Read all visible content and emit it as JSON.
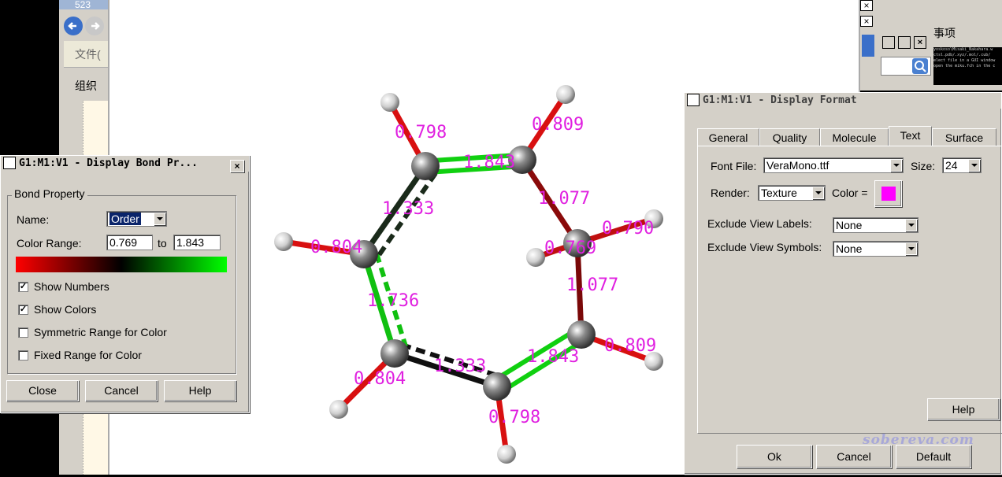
{
  "background": {
    "explorer_title": "523",
    "menu_file": "文件(",
    "menu_organize": "组织",
    "topright_text": "事项",
    "terminal_lines": [
      "yoskoso\\Misaki_Nakahara.w",
      "ctsl.pdb/.xyz/.mol/.cub/",
      "elect file in a GUI window",
      "open the miku.fch in the c"
    ]
  },
  "bond_dialog": {
    "title": "G1:M1:V1 - Display Bond Pr...",
    "group_label": "Bond Property",
    "name_label": "Name:",
    "name_value": "Order",
    "color_range_label": "Color Range:",
    "range_min": "0.769",
    "range_to": "to",
    "range_max": "1.843",
    "checkboxes": [
      {
        "label": "Show Numbers",
        "checked": true
      },
      {
        "label": "Show Colors",
        "checked": true
      },
      {
        "label": "Symmetric Range for Color",
        "checked": false
      },
      {
        "label": "Fixed Range for Color",
        "checked": false
      }
    ],
    "buttons": {
      "close": "Close",
      "cancel": "Cancel",
      "help": "Help"
    },
    "gradient_colors": [
      "#ff0000",
      "#000000",
      "#00ff00"
    ]
  },
  "format_dialog": {
    "title": "G1:M1:V1 - Display Format",
    "tabs": [
      "General",
      "Quality",
      "Molecule",
      "Text",
      "Surface"
    ],
    "active_tab": "Text",
    "font_file_label": "Font File:",
    "font_file_value": "VeraMono.ttf",
    "size_label": "Size:",
    "size_value": "24",
    "render_label": "Render:",
    "render_value": "Texture",
    "color_label": "Color =",
    "text_color": "#ff00ff",
    "exclude_labels_label": "Exclude View Labels:",
    "exclude_labels_value": "None",
    "exclude_symbols_label": "Exclude View Symbols:",
    "exclude_symbols_value": "None",
    "help_button": "Help",
    "watermark": "sobereva.com",
    "buttons": {
      "ok": "Ok",
      "cancel": "Cancel",
      "default": "Default"
    }
  },
  "molecule": {
    "bond_labels": [
      "0.798",
      "1.843",
      "0.809",
      "1.333",
      "1.077",
      "0.790",
      "0.804",
      "0.769",
      "1.077",
      "1.736",
      "0.809",
      "1.843",
      "1.333",
      "0.804",
      "0.798"
    ]
  }
}
